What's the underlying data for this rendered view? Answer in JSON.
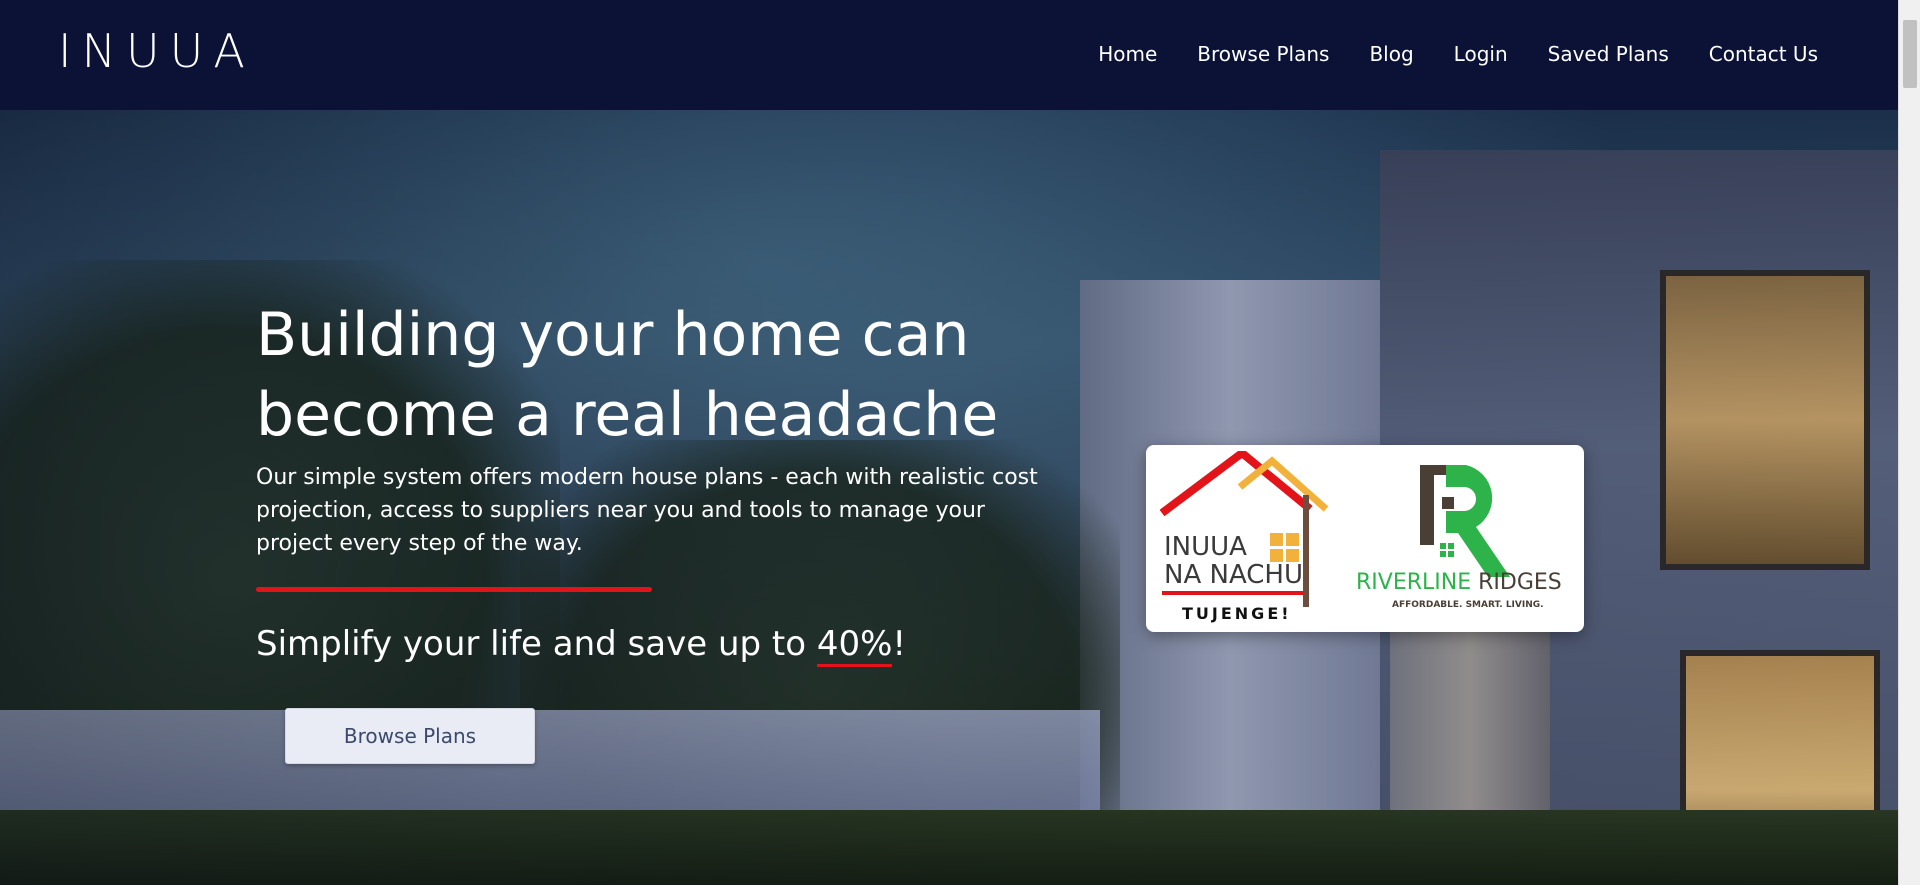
{
  "header": {
    "logo_text": "INUUA",
    "nav": [
      {
        "label": "Home"
      },
      {
        "label": "Browse Plans"
      },
      {
        "label": "Blog"
      },
      {
        "label": "Login"
      },
      {
        "label": "Saved Plans"
      },
      {
        "label": "Contact Us"
      }
    ]
  },
  "hero": {
    "title": "Building your home can become a real headache",
    "description": "Our simple system offers modern house plans - each with realistic cost projection, access to suppliers near you and tools to manage your project every step of the way.",
    "tagline_prefix": "Simplify your life and save up to ",
    "tagline_highlight": "40%",
    "tagline_suffix": "!",
    "cta_label": "Browse Plans"
  },
  "partners": {
    "partner1": {
      "line1_a": "INUUA",
      "line1_b": "NA NACHU",
      "tagline": "TUJENGE!"
    },
    "partner2": {
      "name_a": "RIVERLINE",
      "name_b": " RIDGES",
      "tagline": "AFFORDABLE. SMART. LIVING."
    }
  },
  "colors": {
    "header_bg": "#0b1236",
    "accent_red": "#e3131a",
    "riverline_green": "#2db34a",
    "inuua_orange": "#f2b13a"
  }
}
